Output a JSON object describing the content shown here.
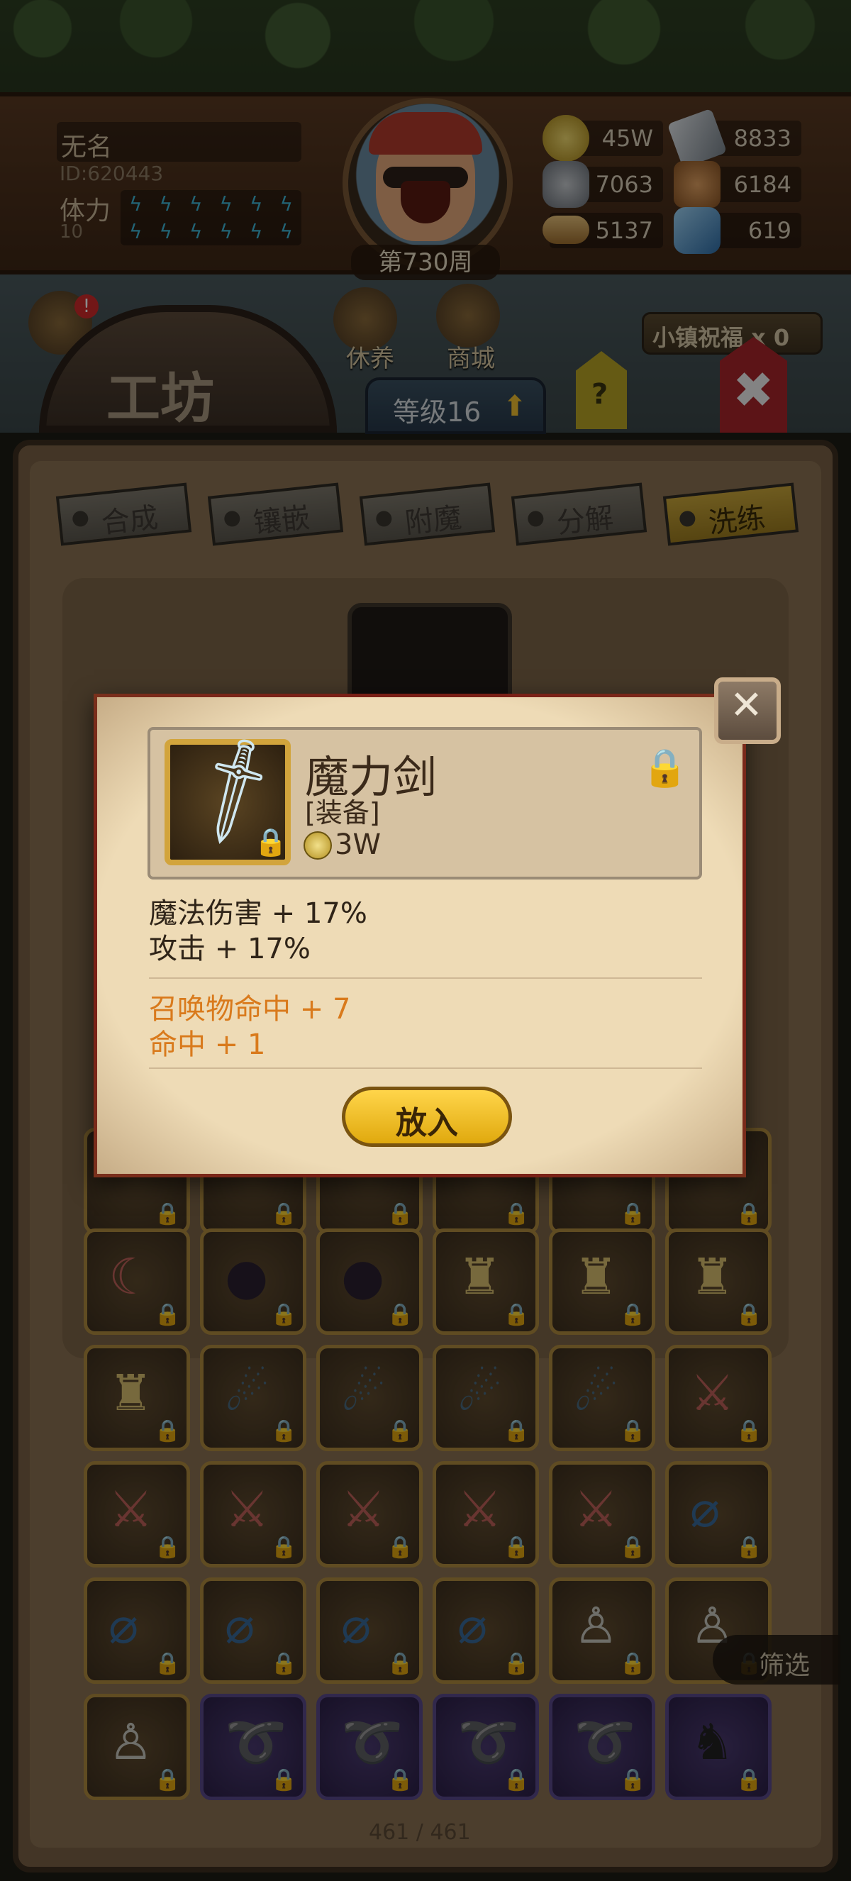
{
  "player": {
    "name": "无名",
    "id": "ID:620443",
    "stamina_label": "体力",
    "stamina_value": "10",
    "week": "第730周"
  },
  "resources": [
    {
      "icon": "gold-coin-icon",
      "value": "45W"
    },
    {
      "icon": "iron-ingot-icon",
      "value": "8833"
    },
    {
      "icon": "ore-icon",
      "value": "7063"
    },
    {
      "icon": "leather-icon",
      "value": "6184"
    },
    {
      "icon": "wood-icon",
      "value": "5137"
    },
    {
      "icon": "crystal-icon",
      "value": "619"
    }
  ],
  "menu": {
    "rest": "休养",
    "shop": "商城",
    "bless": "小镇祝福 x 0"
  },
  "workshop": {
    "title": "工坊",
    "level": "等级16",
    "help": "?",
    "tabs": [
      "合成",
      "镶嵌",
      "附魔",
      "分解",
      "洗练"
    ],
    "active_tab": "洗练",
    "count": "461 / 461",
    "filter": "筛选"
  },
  "dialog": {
    "item_name": "魔力剑",
    "item_type": "[装备]",
    "price": "3W",
    "stats": [
      "魔法伤害 + 17%",
      "攻击 + 17%"
    ],
    "extra_stats": [
      "召唤物命中 + 7",
      "命中 + 1"
    ],
    "button": "放入"
  },
  "colors": {
    "accent_gold": "#d2a43c",
    "extra_stat": "#d97a1c",
    "dialog_border": "#7a1f16",
    "close_red": "#a8262a"
  }
}
